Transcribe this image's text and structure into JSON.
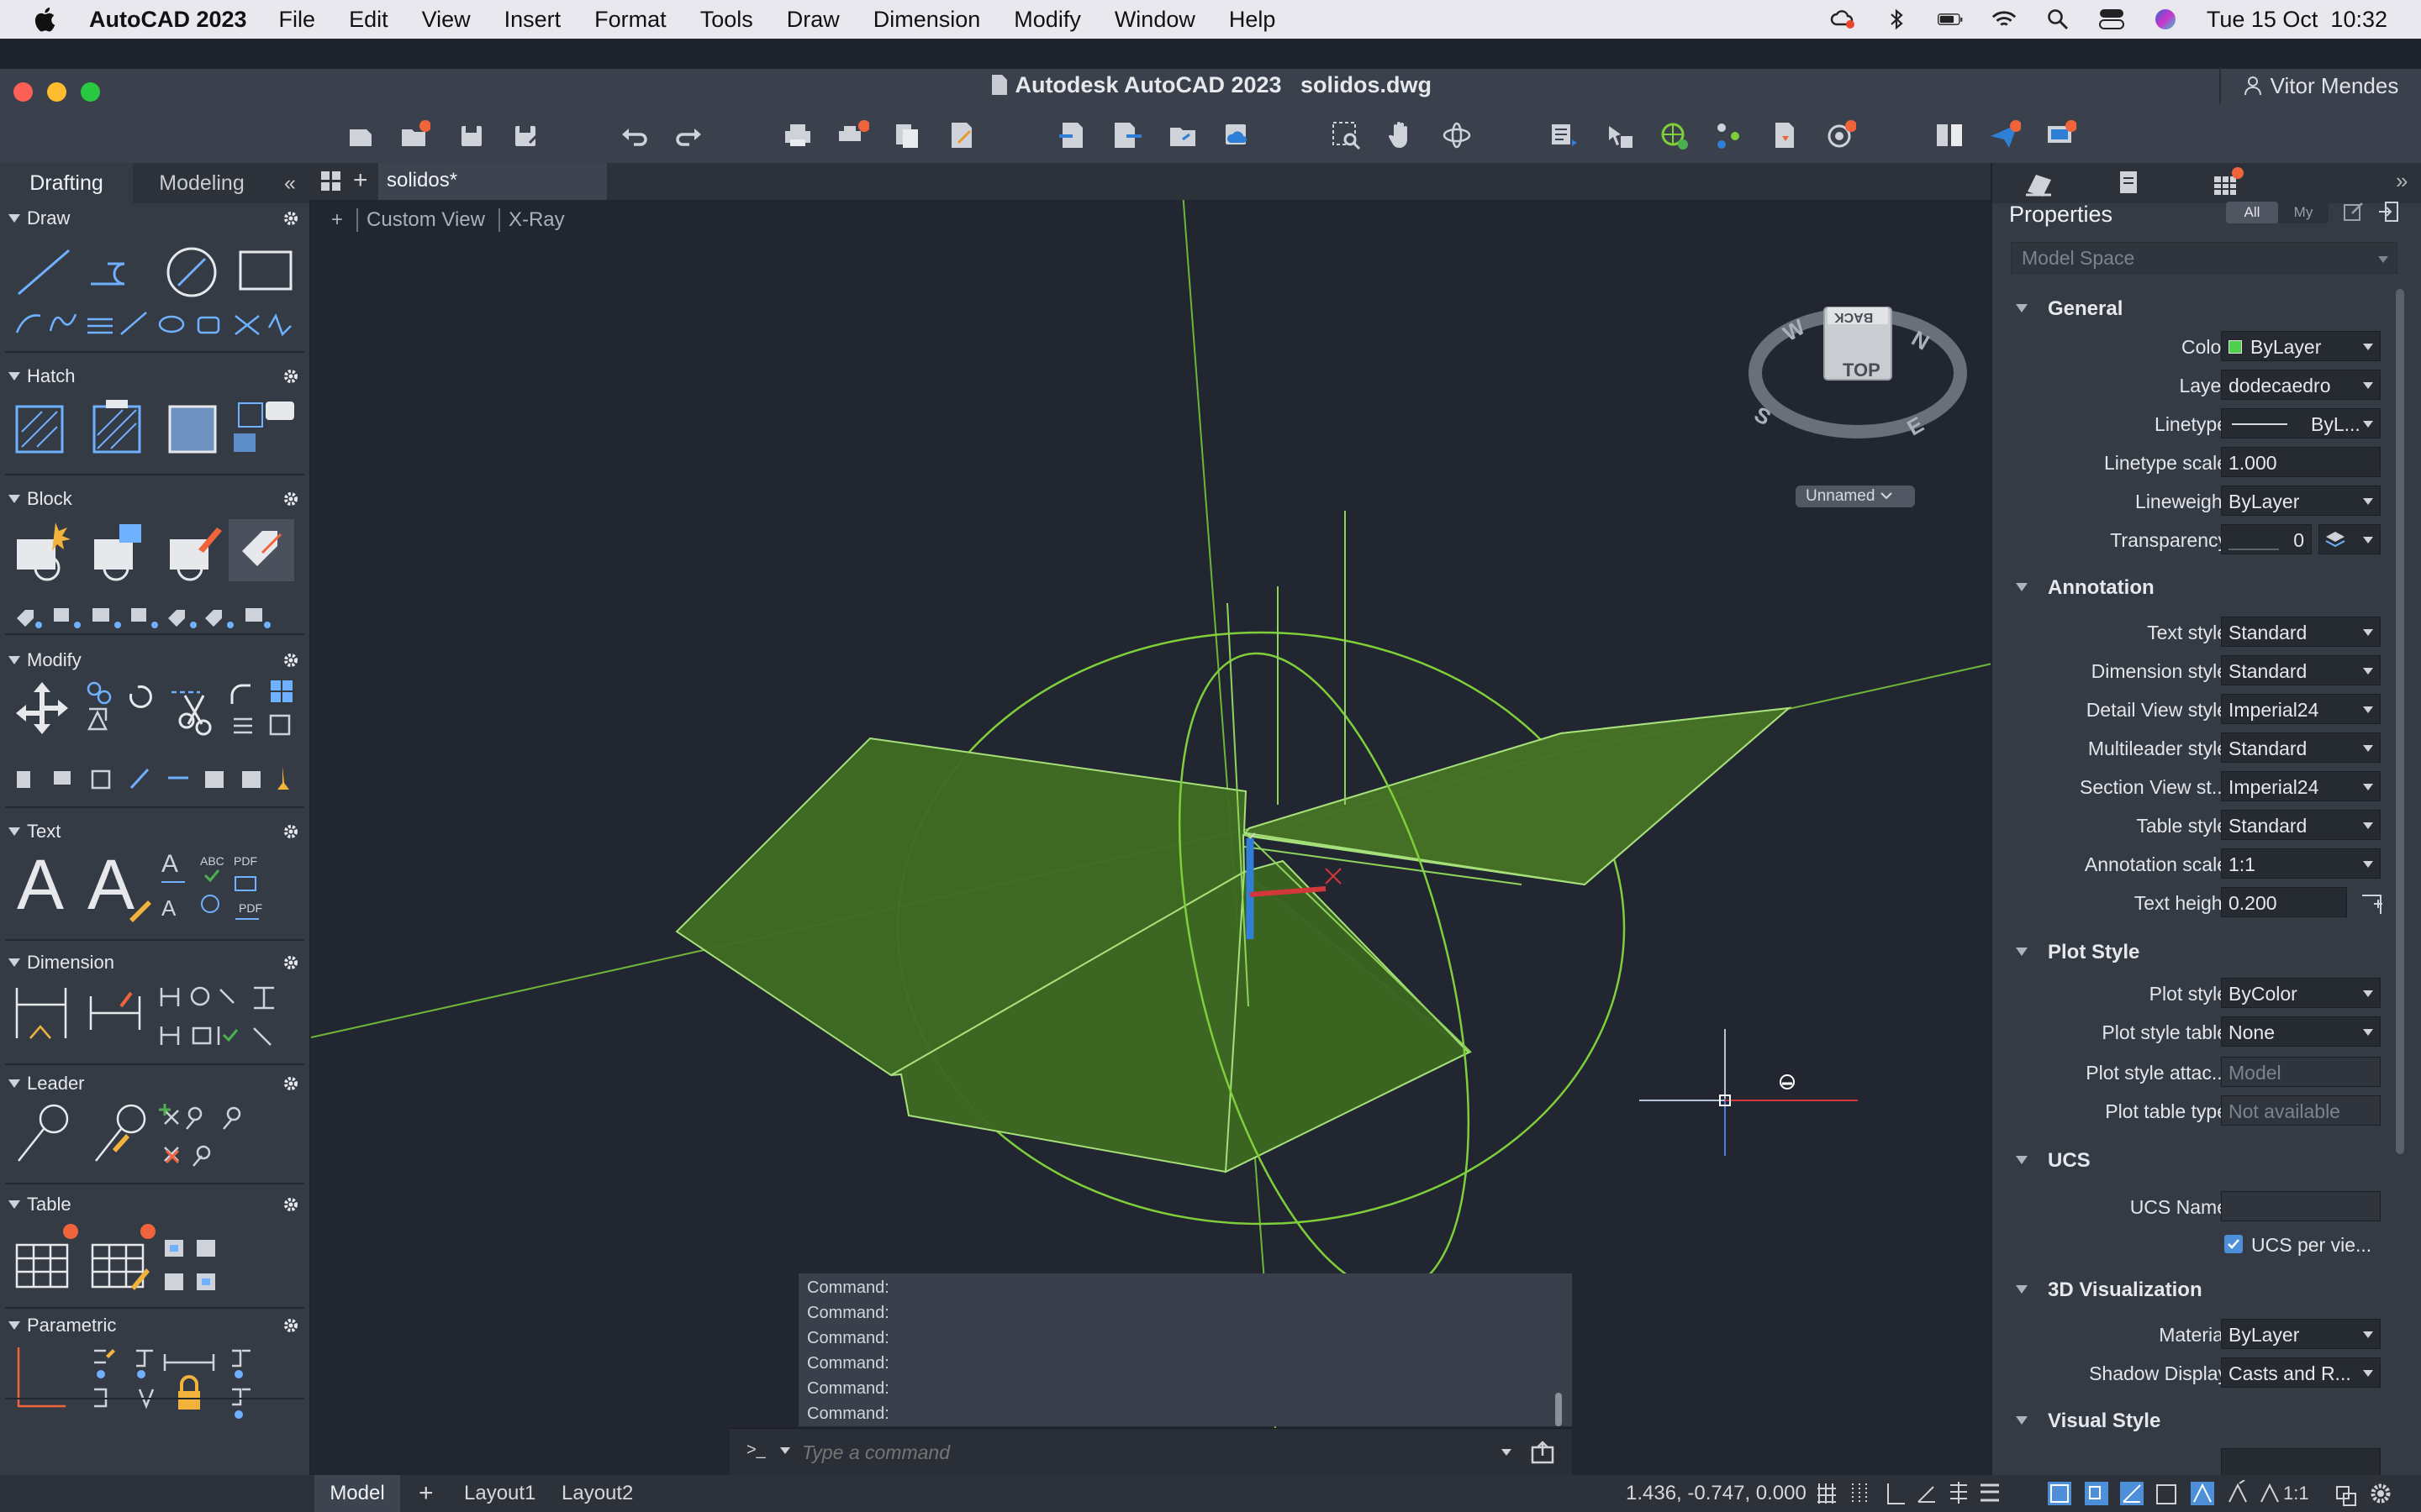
{
  "menubar": {
    "app_name": "AutoCAD 2023",
    "items": [
      "File",
      "Edit",
      "View",
      "Insert",
      "Format",
      "Tools",
      "Draw",
      "Dimension",
      "Modify",
      "Window",
      "Help"
    ],
    "date": "Tue 15 Oct",
    "time": "10:32"
  },
  "window": {
    "title": "Autodesk AutoCAD 2023",
    "filename": "solidos.dwg",
    "user": "Vitor Mendes"
  },
  "left_tabs": {
    "drafting": "Drafting",
    "modeling": "Modeling"
  },
  "doc_tab": "solidos*",
  "palette": {
    "sections": [
      "Draw",
      "Hatch",
      "Block",
      "Modify",
      "Text",
      "Dimension",
      "Leader",
      "Table",
      "Parametric"
    ]
  },
  "viewport": {
    "view_label": "Custom View",
    "style_label": "X-Ray",
    "plus_label": "+",
    "viewcube_top": "TOP",
    "viewcube_back": "BACK",
    "compass": {
      "n": "N",
      "e": "E",
      "s": "S",
      "w": "W"
    },
    "ucs_name": "Unnamed"
  },
  "properties": {
    "title": "Properties",
    "filter_all": "All",
    "filter_my": "My",
    "selector": "Model Space",
    "general": {
      "heading": "General",
      "color_label": "Color",
      "color_value": "ByLayer",
      "layer_label": "Layer",
      "layer_value": "dodecaedro",
      "linetype_label": "Linetype",
      "linetype_value": "ByL...",
      "linetype_scale_label": "Linetype scale",
      "linetype_scale_value": "1.000",
      "lineweight_label": "Lineweight",
      "lineweight_value": "ByLayer",
      "transparency_label": "Transparency",
      "transparency_value": "0"
    },
    "annotation": {
      "heading": "Annotation",
      "text_style_label": "Text style",
      "text_style_value": "Standard",
      "dim_style_label": "Dimension style",
      "dim_style_value": "Standard",
      "detail_view_label": "Detail View style",
      "detail_view_value": "Imperial24",
      "mleader_label": "Multileader style",
      "mleader_value": "Standard",
      "section_view_label": "Section View st...",
      "section_view_value": "Imperial24",
      "table_style_label": "Table style",
      "table_style_value": "Standard",
      "annot_scale_label": "Annotation scale",
      "annot_scale_value": "1:1",
      "text_height_label": "Text height",
      "text_height_value": "0.200"
    },
    "plot_style": {
      "heading": "Plot Style",
      "plot_style_label": "Plot style",
      "plot_style_value": "ByColor",
      "plot_style_table_label": "Plot style table",
      "plot_style_table_value": "None",
      "plot_style_attach_label": "Plot style attac...",
      "plot_style_attach_value": "Model",
      "plot_table_type_label": "Plot table type",
      "plot_table_type_value": "Not available"
    },
    "ucs": {
      "heading": "UCS",
      "ucs_name_label": "UCS Name",
      "ucs_name_value": "",
      "ucs_per_view_label": "UCS per vie..."
    },
    "visualization": {
      "heading": "3D Visualization",
      "material_label": "Material",
      "material_value": "ByLayer",
      "shadow_label": "Shadow Display",
      "shadow_value": "Casts and R..."
    },
    "visual_style": {
      "heading": "Visual Style"
    }
  },
  "command": {
    "history": [
      "Command:",
      "Command:",
      "Command:",
      "Command:",
      "Command:",
      "Command:"
    ],
    "placeholder": "Type a command",
    "prompt": ">_"
  },
  "status": {
    "tabs": [
      "Model",
      "Layout1",
      "Layout2"
    ],
    "coords": "1.436, -0.747, 0.000",
    "scale": "1:1"
  },
  "colors": {
    "solid_fill": "#3f6b22",
    "wire": "#7fcf3a",
    "accent_blue": "#2f7fd6",
    "badge": "#f0643c"
  }
}
